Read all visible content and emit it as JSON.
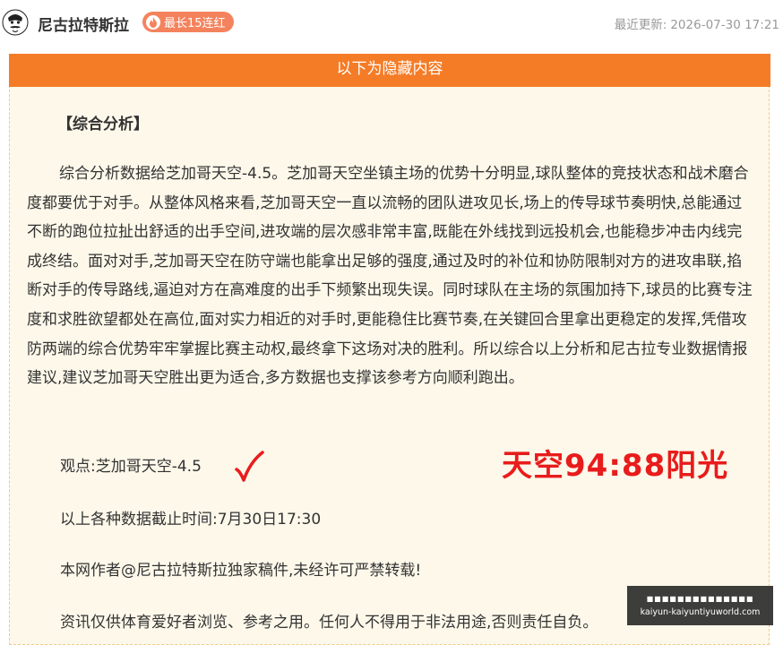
{
  "header": {
    "author": "尼古拉特斯拉",
    "streak_badge": "最长15连红",
    "updated_label": "最近更新:",
    "updated_time": "2026-07-30 17:21"
  },
  "hidden_section": {
    "banner": "以下为隐藏内容",
    "title": "【综合分析】",
    "paragraph": "综合分析数据给芝加哥天空-4.5。芝加哥天空坐镇主场的优势十分明显,球队整体的竞技状态和战术磨合度都要优于对手。从整体风格来看,芝加哥天空一直以流畅的团队进攻见长,场上的传导球节奏明快,总能通过不断的跑位拉扯出舒适的出手空间,进攻端的层次感非常丰富,既能在外线找到远投机会,也能稳步冲击内线完成终结。面对对手,芝加哥天空在防守端也能拿出足够的强度,通过及时的补位和协防限制对方的进攻串联,掐断对手的传导路线,逼迫对方在高难度的出手下频繁出现失误。同时球队在主场的氛围加持下,球员的比赛专注度和求胜欲望都处在高位,面对实力相近的对手时,更能稳住比赛节奏,在关键回合里拿出更稳定的发挥,凭借攻防两端的综合优势牢牢掌握比赛主动权,最终拿下这场对决的胜利。所以综合以上分析和尼古拉专业数据情报建议,建议芝加哥天空胜出更为适合,多方数据也支撑该参考方向顺利跑出。",
    "viewpoint": "观点:芝加哥天空-4.5",
    "result_text": "天空94:88阳光",
    "cutoff": "以上各种数据截止时间:7月30日17:30",
    "copyright": "本网作者@尼古拉特斯拉独家稿件,未经许可严禁转载!",
    "disclaimer": "资讯仅供体育爱好者浏览、参考之用。任何人不得用于非法用途,否则责任自负。"
  },
  "watermark": {
    "line1": "■■■■■■■■■■■■■■",
    "line2": "kaiyun-kaiyuntiyuworld.com"
  },
  "colors": {
    "accent": "#f57c27",
    "badge": "#f4835d",
    "result": "#e81c1c",
    "panel": "#fdf8ea"
  }
}
